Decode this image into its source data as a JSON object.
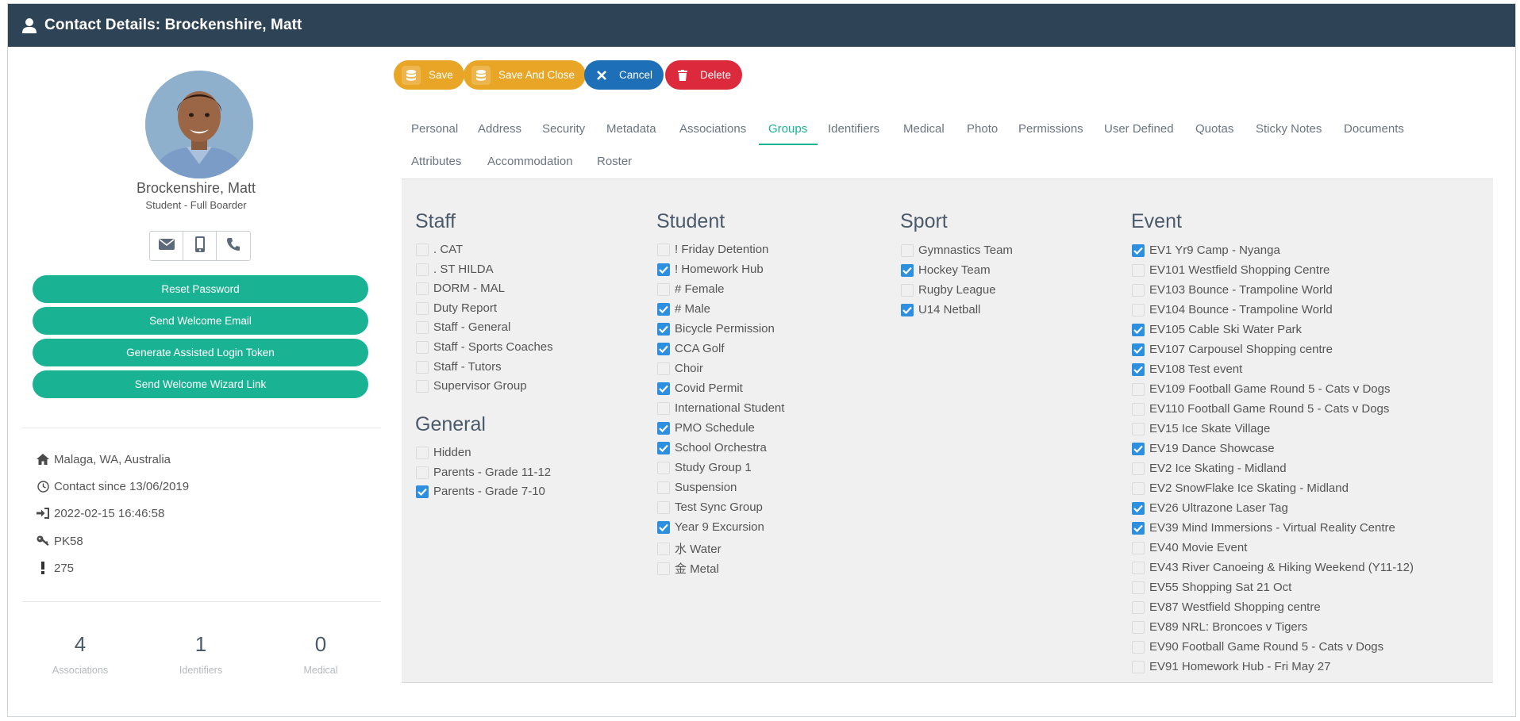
{
  "window": {
    "title": "Contact Details: Brockenshire, Matt"
  },
  "profile": {
    "name": "Brockenshire, Matt",
    "role": "Student - Full Boarder",
    "buttons": {
      "reset_password": "Reset Password",
      "send_welcome_email": "Send Welcome Email",
      "generate_login_token": "Generate Assisted Login Token",
      "send_wizard_link": "Send Welcome Wizard Link"
    },
    "info": {
      "location": "Malaga, WA, Australia",
      "contact_since": "Contact since 13/06/2019",
      "last_login": "2022-02-15 16:46:58",
      "code": "PK58",
      "alert_id": "275"
    },
    "stats": [
      {
        "value": "4",
        "label": "Associations"
      },
      {
        "value": "1",
        "label": "Identifiers"
      },
      {
        "value": "0",
        "label": "Medical"
      }
    ]
  },
  "actions": {
    "save": "Save",
    "save_and_close": "Save And Close",
    "cancel": "Cancel",
    "delete": "Delete"
  },
  "colors": {
    "header": "#2f4356",
    "accent": "#19b394",
    "save": "#e8a526",
    "cancel": "#1d70b8",
    "delete": "#dc2a3c",
    "checkbox": "#2d8fe0"
  },
  "tabs": [
    "Personal",
    "Address",
    "Security",
    "Metadata",
    "Associations",
    "Groups",
    "Identifiers",
    "Medical",
    "Photo",
    "Permissions",
    "User Defined",
    "Quotas",
    "Sticky Notes",
    "Documents",
    "Attributes",
    "Accommodation",
    "Roster"
  ],
  "active_tab": "Groups",
  "groups": {
    "staff": {
      "title": "Staff",
      "items": [
        {
          "label": ". CAT",
          "checked": false
        },
        {
          "label": ". ST HILDA",
          "checked": false
        },
        {
          "label": "DORM - MAL",
          "checked": false
        },
        {
          "label": "Duty Report",
          "checked": false
        },
        {
          "label": "Staff - General",
          "checked": false
        },
        {
          "label": "Staff - Sports Coaches",
          "checked": false
        },
        {
          "label": "Staff - Tutors",
          "checked": false
        },
        {
          "label": "Supervisor Group",
          "checked": false
        }
      ]
    },
    "general": {
      "title": "General",
      "items": [
        {
          "label": "Hidden",
          "checked": false
        },
        {
          "label": "Parents - Grade 11-12",
          "checked": false
        },
        {
          "label": "Parents - Grade 7-10",
          "checked": true
        }
      ]
    },
    "student": {
      "title": "Student",
      "items": [
        {
          "label": "! Friday Detention",
          "checked": false
        },
        {
          "label": "! Homework Hub",
          "checked": true
        },
        {
          "label": "# Female",
          "checked": false
        },
        {
          "label": "# Male",
          "checked": true
        },
        {
          "label": "Bicycle Permission",
          "checked": true
        },
        {
          "label": "CCA Golf",
          "checked": true
        },
        {
          "label": "Choir",
          "checked": false
        },
        {
          "label": "Covid Permit",
          "checked": true
        },
        {
          "label": "International Student",
          "checked": false
        },
        {
          "label": "PMO Schedule",
          "checked": true
        },
        {
          "label": "School Orchestra",
          "checked": true
        },
        {
          "label": "Study Group 1",
          "checked": false
        },
        {
          "label": "Suspension",
          "checked": false
        },
        {
          "label": "Test Sync Group",
          "checked": false
        },
        {
          "label": "Year 9 Excursion",
          "checked": true
        },
        {
          "label": "水 Water",
          "checked": false
        },
        {
          "label": "金 Metal",
          "checked": false
        }
      ]
    },
    "sport": {
      "title": "Sport",
      "items": [
        {
          "label": "Gymnastics Team",
          "checked": false
        },
        {
          "label": "Hockey Team",
          "checked": true
        },
        {
          "label": "Rugby League",
          "checked": false
        },
        {
          "label": "U14 Netball",
          "checked": true
        }
      ]
    },
    "event": {
      "title": "Event",
      "items": [
        {
          "label": "EV1 Yr9 Camp - Nyanga",
          "checked": true
        },
        {
          "label": "EV101 Westfield Shopping Centre",
          "checked": false
        },
        {
          "label": "EV103 Bounce - Trampoline World",
          "checked": false
        },
        {
          "label": "EV104 Bounce - Trampoline World",
          "checked": false
        },
        {
          "label": "EV105 Cable Ski Water Park",
          "checked": true
        },
        {
          "label": "EV107 Carpousel Shopping centre",
          "checked": true
        },
        {
          "label": "EV108 Test event",
          "checked": true
        },
        {
          "label": "EV109 Football Game Round 5 - Cats v Dogs",
          "checked": false
        },
        {
          "label": "EV110 Football Game Round 5 - Cats v Dogs",
          "checked": false
        },
        {
          "label": "EV15 Ice Skate Village",
          "checked": false
        },
        {
          "label": "EV19 Dance Showcase",
          "checked": true
        },
        {
          "label": "EV2 Ice Skating - Midland",
          "checked": false
        },
        {
          "label": "EV2 SnowFlake Ice Skating - Midland",
          "checked": false
        },
        {
          "label": "EV26 Ultrazone Laser Tag",
          "checked": true
        },
        {
          "label": "EV39 Mind Immersions - Virtual Reality Centre",
          "checked": true
        },
        {
          "label": "EV40 Movie Event",
          "checked": false
        },
        {
          "label": "EV43 River Canoeing & Hiking Weekend (Y11-12)",
          "checked": false
        },
        {
          "label": "EV55 Shopping Sat 21 Oct",
          "checked": false
        },
        {
          "label": "EV87 Westfield Shopping centre",
          "checked": false
        },
        {
          "label": "EV89 NRL: Broncoes v Tigers",
          "checked": false
        },
        {
          "label": "EV90 Football Game Round 5 - Cats v Dogs",
          "checked": false
        },
        {
          "label": "EV91 Homework Hub - Fri May 27",
          "checked": false
        }
      ]
    }
  }
}
